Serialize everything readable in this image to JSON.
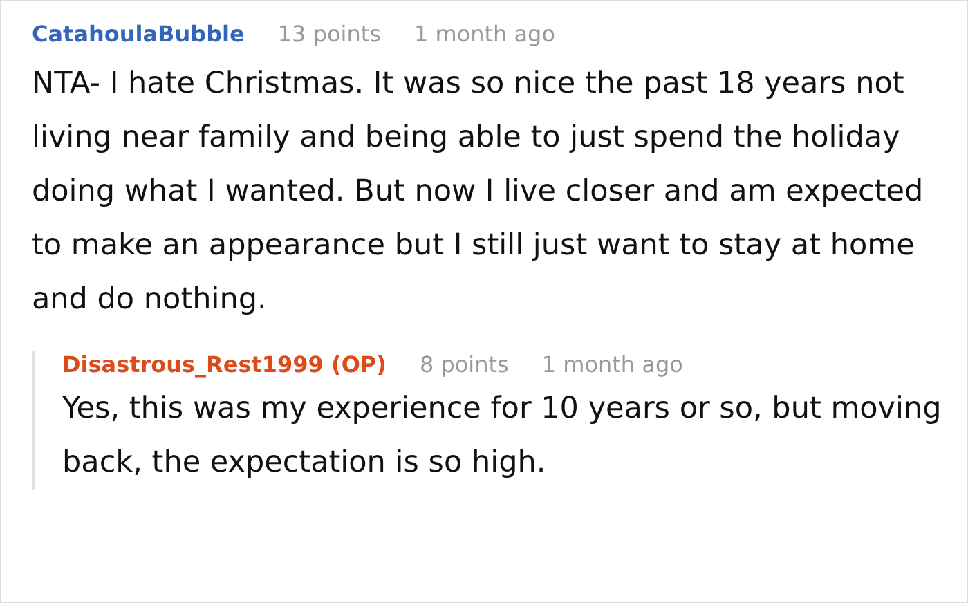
{
  "comments": [
    {
      "author": "CatahoulaBubble",
      "color": "#3366bb",
      "points": "13 points",
      "time": "1 month ago",
      "text": "NTA- I hate Christmas. It was so nice the past 18 years not living near family and being able to just spend the holiday doing what I wanted. But now I live closer and am expected to make an appearance but I still just want to stay at home and do nothing.",
      "children": [
        {
          "author": "Disastrous_Rest1999 (OP)",
          "color": "#dd4b1a",
          "points": "8 points",
          "time": "1 month ago",
          "text": "Yes, this was my experience for 10 years or so, but moving back, the expectation is so high."
        }
      ]
    }
  ]
}
